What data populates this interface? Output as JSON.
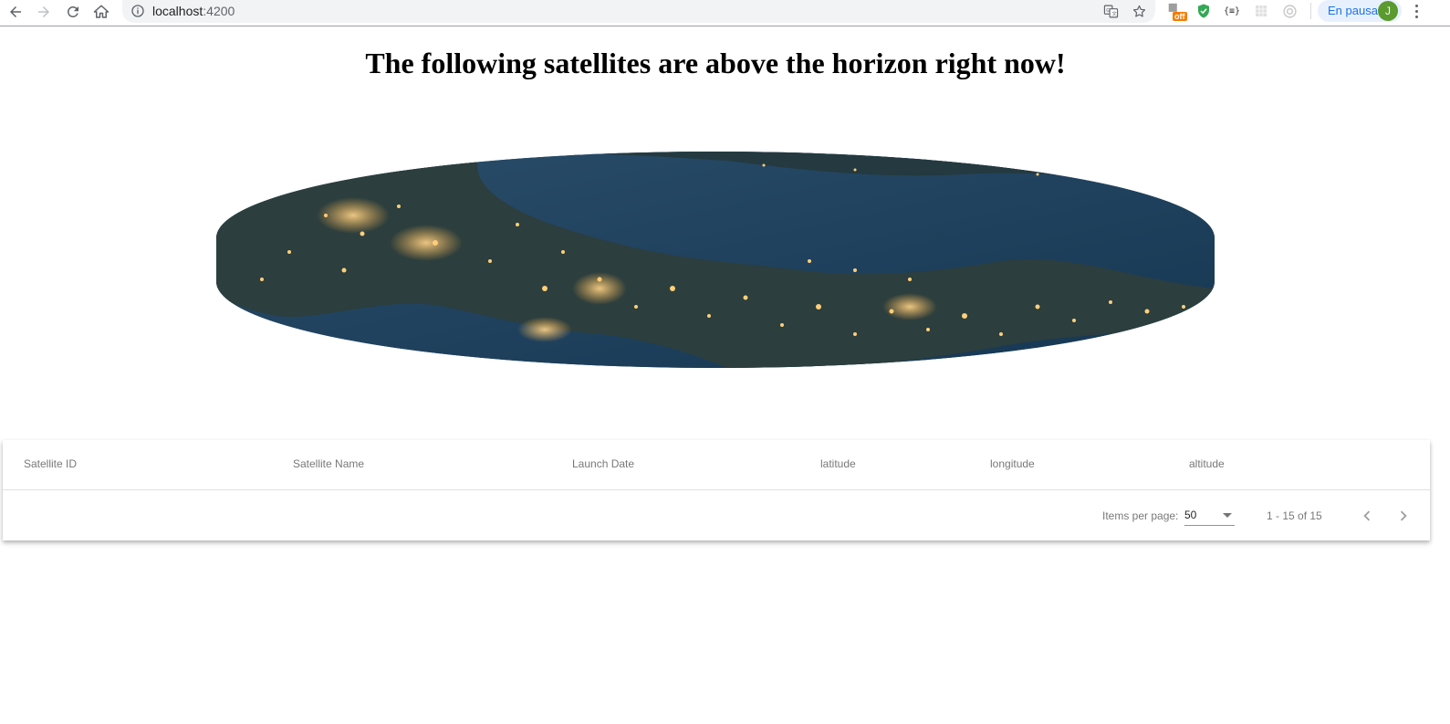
{
  "browser": {
    "url_host": "localhost",
    "url_port": ":4200",
    "extension_badge": "off",
    "extension_braces": "{≡}",
    "profile_status": "En pausa",
    "profile_initial": "J",
    "icons": [
      "back-icon",
      "forward-icon",
      "reload-icon",
      "home-icon",
      "info-icon",
      "translate-icon",
      "star-icon",
      "shield-icon",
      "kebab-menu-icon"
    ]
  },
  "page": {
    "title": "The following satellites are above the horizon right now!",
    "image_alt": "Earth at night from orbit"
  },
  "table": {
    "columns": [
      "Satellite ID",
      "Satellite Name",
      "Launch Date",
      "latitude",
      "longitude",
      "altitude"
    ],
    "rows": []
  },
  "paginator": {
    "items_per_page_label": "Items per page:",
    "items_per_page_value": "50",
    "range_label": "1 - 15 of 15"
  },
  "colors": {
    "profile_pill_bg": "#e8f0fe",
    "profile_text": "#1a73e8",
    "avatar_bg": "#5a9a2e",
    "shield_green": "#34a853",
    "badge_orange": "#f57c00"
  }
}
